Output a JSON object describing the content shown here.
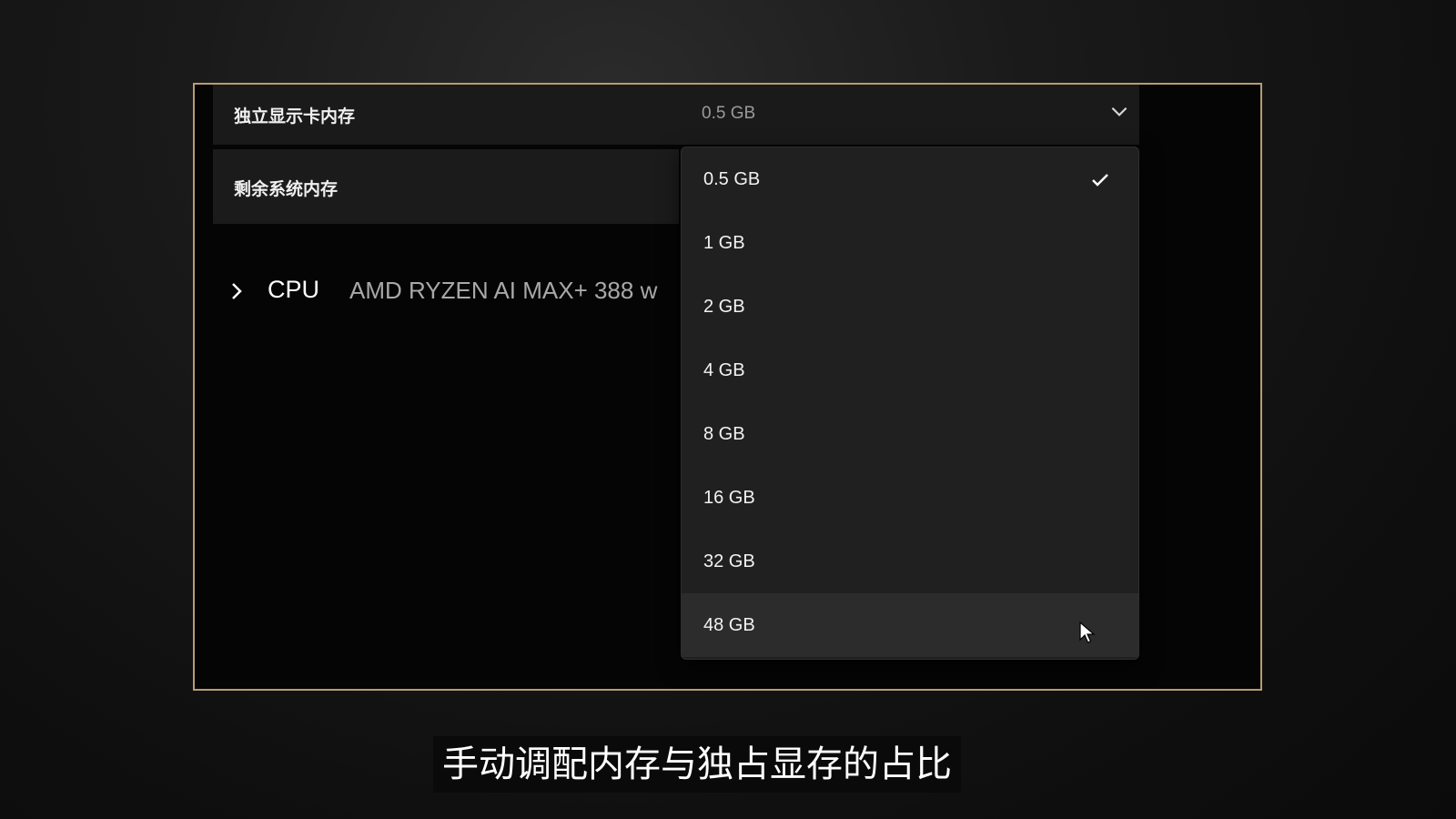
{
  "settings": {
    "vram_label": "独立显示卡内存",
    "vram_value": "0.5 GB",
    "remaining_label": "剩余系统内存"
  },
  "cpu": {
    "title": "CPU",
    "model": "AMD RYZEN AI MAX+ 388 w"
  },
  "dropdown": {
    "options": [
      {
        "label": "0.5 GB",
        "selected": true
      },
      {
        "label": "1 GB",
        "selected": false
      },
      {
        "label": "2 GB",
        "selected": false
      },
      {
        "label": "4 GB",
        "selected": false
      },
      {
        "label": "8 GB",
        "selected": false
      },
      {
        "label": "16 GB",
        "selected": false
      },
      {
        "label": "32 GB",
        "selected": false
      },
      {
        "label": "48 GB",
        "selected": false,
        "hovered": true
      }
    ]
  },
  "subtitle": "手动调配内存与独占显存的占比",
  "icons": {
    "combo": "chevron-down-icon",
    "cpu_expand": "chevron-right-icon",
    "selected": "check-icon",
    "pointer": "mouse-cursor-icon"
  },
  "colors": {
    "frame_border": "#b79c72",
    "dropdown_bg": "#202020",
    "hover_bg": "#2c2c2c"
  }
}
